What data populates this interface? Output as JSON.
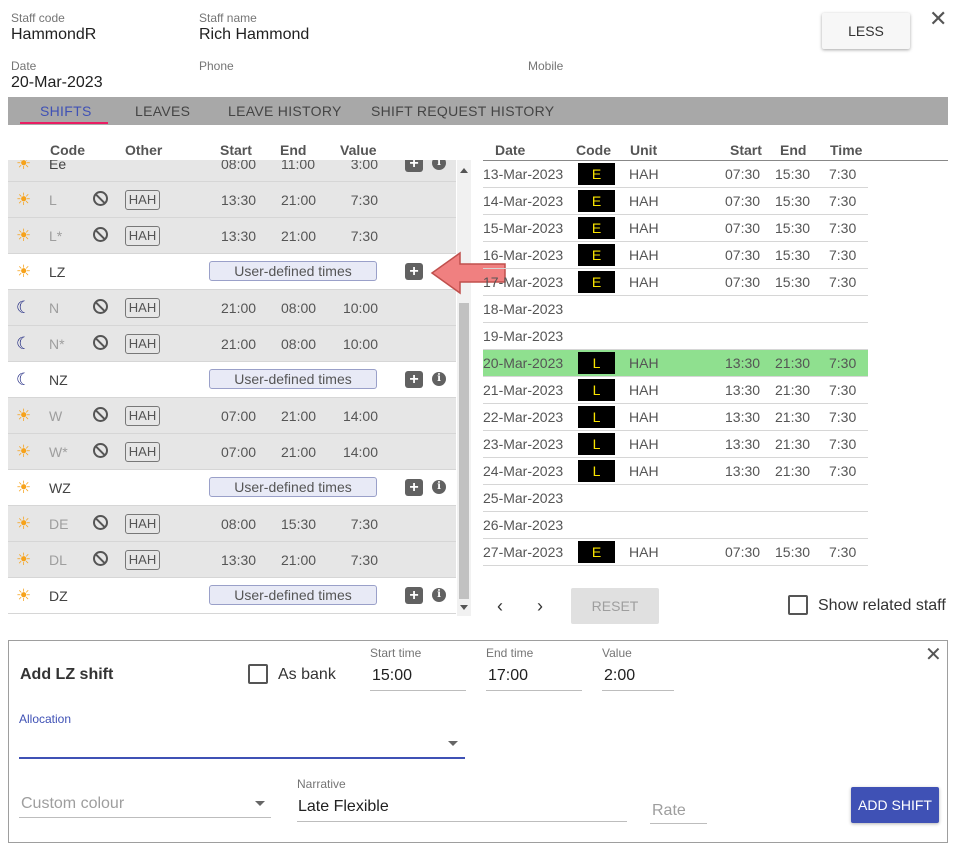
{
  "staff": {
    "code_label": "Staff code",
    "code": "HammondR",
    "name_label": "Staff name",
    "name": "Rich Hammond",
    "date_label": "Date",
    "date": "20-Mar-2023",
    "phone_label": "Phone",
    "phone": "",
    "mobile_label": "Mobile",
    "mobile": ""
  },
  "less_label": "LESS",
  "tabs": [
    "SHIFTS",
    "LEAVES",
    "LEAVE HISTORY",
    "SHIFT REQUEST HISTORY"
  ],
  "shift_list": {
    "headers": {
      "code": "Code",
      "other": "Other",
      "start": "Start",
      "end": "End",
      "value": "Value"
    },
    "rows": [
      {
        "icon": "sun-icon",
        "code": "Ee",
        "start": "08:00",
        "end": "11:00",
        "value": "3:00",
        "partial": true
      },
      {
        "icon": "sun-icon",
        "code": "L",
        "blocked": true,
        "unit": "HAH",
        "start": "13:30",
        "end": "21:00",
        "value": "7:30"
      },
      {
        "icon": "sun-icon",
        "code": "L*",
        "blocked": true,
        "unit": "HAH",
        "start": "13:30",
        "end": "21:00",
        "value": "7:30"
      },
      {
        "icon": "sun-icon",
        "code": "LZ",
        "user_defined": "User-defined times"
      },
      {
        "icon": "moon-icon",
        "code": "N",
        "blocked": true,
        "unit": "HAH",
        "start": "21:00",
        "end": "08:00",
        "value": "10:00"
      },
      {
        "icon": "moon-icon",
        "code": "N*",
        "blocked": true,
        "unit": "HAH",
        "start": "21:00",
        "end": "08:00",
        "value": "10:00"
      },
      {
        "icon": "moon-icon",
        "code": "NZ",
        "user_defined": "User-defined times"
      },
      {
        "icon": "sun-icon",
        "code": "W",
        "blocked": true,
        "unit": "HAH",
        "start": "07:00",
        "end": "21:00",
        "value": "14:00"
      },
      {
        "icon": "sun-icon",
        "code": "W*",
        "blocked": true,
        "unit": "HAH",
        "start": "07:00",
        "end": "21:00",
        "value": "14:00"
      },
      {
        "icon": "sun-icon",
        "code": "WZ",
        "user_defined": "User-defined times"
      },
      {
        "icon": "sun-icon",
        "code": "DE",
        "blocked": true,
        "unit": "HAH",
        "start": "08:00",
        "end": "15:30",
        "value": "7:30"
      },
      {
        "icon": "sun-icon",
        "code": "DL",
        "blocked": true,
        "unit": "HAH",
        "start": "13:30",
        "end": "21:00",
        "value": "7:30"
      },
      {
        "icon": "sun-icon",
        "code": "DZ",
        "user_defined": "User-defined times"
      }
    ]
  },
  "schedule": {
    "headers": {
      "date": "Date",
      "code": "Code",
      "unit": "Unit",
      "start": "Start",
      "end": "End",
      "time": "Time"
    },
    "rows": [
      {
        "date": "13-Mar-2023",
        "code": "E",
        "unit": "HAH",
        "start": "07:30",
        "end": "15:30",
        "time": "7:30"
      },
      {
        "date": "14-Mar-2023",
        "code": "E",
        "unit": "HAH",
        "start": "07:30",
        "end": "15:30",
        "time": "7:30"
      },
      {
        "date": "15-Mar-2023",
        "code": "E",
        "unit": "HAH",
        "start": "07:30",
        "end": "15:30",
        "time": "7:30"
      },
      {
        "date": "16-Mar-2023",
        "code": "E",
        "unit": "HAH",
        "start": "07:30",
        "end": "15:30",
        "time": "7:30"
      },
      {
        "date": "17-Mar-2023",
        "code": "E",
        "unit": "HAH",
        "start": "07:30",
        "end": "15:30",
        "time": "7:30"
      },
      {
        "date": "18-Mar-2023"
      },
      {
        "date": "19-Mar-2023"
      },
      {
        "date": "20-Mar-2023",
        "code": "L",
        "unit": "HAH",
        "start": "13:30",
        "end": "21:30",
        "time": "7:30",
        "highlight": true
      },
      {
        "date": "21-Mar-2023",
        "code": "L",
        "unit": "HAH",
        "start": "13:30",
        "end": "21:30",
        "time": "7:30"
      },
      {
        "date": "22-Mar-2023",
        "code": "L",
        "unit": "HAH",
        "start": "13:30",
        "end": "21:30",
        "time": "7:30"
      },
      {
        "date": "23-Mar-2023",
        "code": "L",
        "unit": "HAH",
        "start": "13:30",
        "end": "21:30",
        "time": "7:30"
      },
      {
        "date": "24-Mar-2023",
        "code": "L",
        "unit": "HAH",
        "start": "13:30",
        "end": "21:30",
        "time": "7:30"
      },
      {
        "date": "25-Mar-2023"
      },
      {
        "date": "26-Mar-2023"
      },
      {
        "date": "27-Mar-2023",
        "code": "E",
        "unit": "HAH",
        "start": "07:30",
        "end": "15:30",
        "time": "7:30"
      }
    ],
    "reset_label": "RESET",
    "show_related_label": "Show related staff"
  },
  "add_shift": {
    "title": "Add LZ shift",
    "as_bank_label": "As bank",
    "start_time_label": "Start time",
    "start_time": "15:00",
    "end_time_label": "End time",
    "end_time": "17:00",
    "value_label": "Value",
    "value": "2:00",
    "allocation_label": "Allocation",
    "allocation": "",
    "custom_colour_placeholder": "Custom colour",
    "narrative_label": "Narrative",
    "narrative": "Late Flexible",
    "rate_placeholder": "Rate",
    "add_button": "ADD SHIFT"
  },
  "colors": {
    "accent": "#3f51b5",
    "tab_indicator": "#e91e63",
    "highlight_row": "#8fe08f",
    "code_badge_bg": "#000000",
    "code_badge_text": "#f9e400",
    "sun_icon": "#f6a21a",
    "moon_icon": "#1a237e",
    "arrow": "#f08080"
  }
}
